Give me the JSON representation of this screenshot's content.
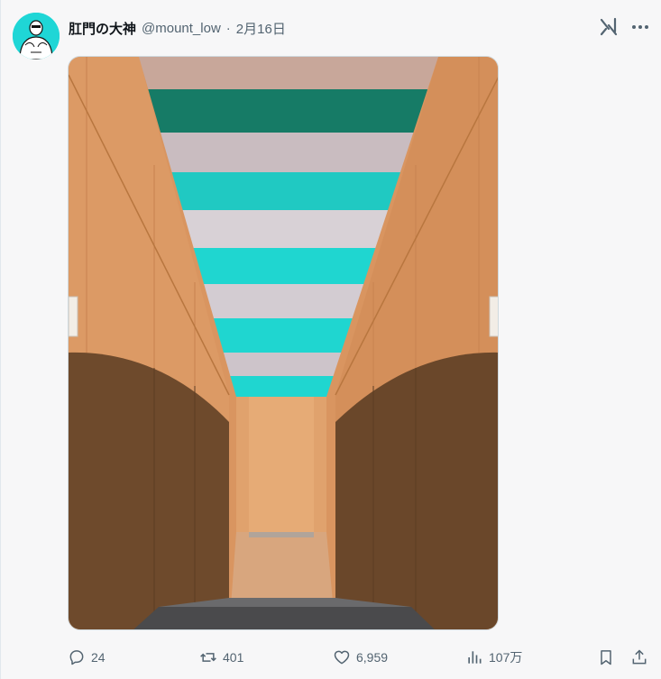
{
  "post": {
    "author": {
      "display_name": "肛門の大神",
      "handle": "@mount_low",
      "avatar_icon": "muscular-masked-figure-avatar"
    },
    "separator": "·",
    "date": "2月16日"
  },
  "header_actions": {
    "grok_icon": "grok-icon",
    "more_icon": "more-dots-icon"
  },
  "stats": {
    "replies": "24",
    "reposts": "401",
    "likes": "6,959",
    "views": "107万"
  },
  "colors": {
    "accent_teal": "#1fd6d6",
    "wall_wood": "#d7935e",
    "lower_panel": "#6b4a2e",
    "muted_text": "#536471"
  }
}
